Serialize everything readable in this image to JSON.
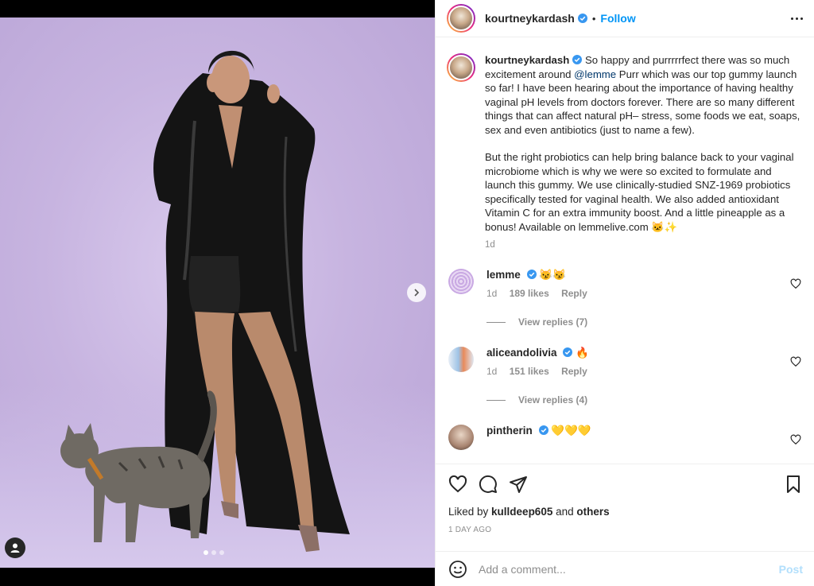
{
  "post": {
    "author": "kourtneykardash",
    "follow_label": "Follow",
    "bullet": "•"
  },
  "caption": {
    "author": "kourtneykardash",
    "text_before_mention": "So happy and purrrrrfect there was so much excitement around ",
    "mention": "@lemme",
    "text_after_mention": " Purr which was our top gummy launch so far! I have been hearing about the importance of having healthy vaginal pH levels from doctors forever. There are so many different things that can affect natural pH– stress, some foods we eat, soaps, sex and even antibiotics (just to name a few).",
    "paragraph2": "But the right probiotics can help bring balance back to your vaginal microbiome which is why we were so excited to formulate and launch this gummy. We use clinically-studied SNZ-1969 probiotics specifically tested for vaginal health. We also added antioxidant Vitamin C for an extra immunity boost. And a little pineapple as a bonus! Available on lemmelive.com 🐱✨",
    "time": "1d"
  },
  "comments": [
    {
      "username": "lemme",
      "text": "😼😼",
      "time": "1d",
      "likes": "189 likes",
      "reply_label": "Reply",
      "view_replies": "View replies (7)"
    },
    {
      "username": "aliceandolivia",
      "text": "🔥",
      "time": "1d",
      "likes": "151 likes",
      "reply_label": "Reply",
      "view_replies": "View replies (4)"
    },
    {
      "username": "pintherin",
      "text": "💛💛💛"
    }
  ],
  "actions": {
    "liked_prefix": "Liked by ",
    "liked_user": "kulldeep605",
    "liked_and": " and ",
    "liked_others": "others",
    "time_ago": "1 DAY AGO"
  },
  "composer": {
    "placeholder": "Add a comment...",
    "post_label": "Post"
  },
  "colors": {
    "link_blue": "#0095f6",
    "verified_blue": "#3897f0",
    "post_disabled": "#b2dffc",
    "background_lavender": "#c7b4e0"
  },
  "carousel": {
    "slide_count": 3,
    "active_index": 0
  }
}
